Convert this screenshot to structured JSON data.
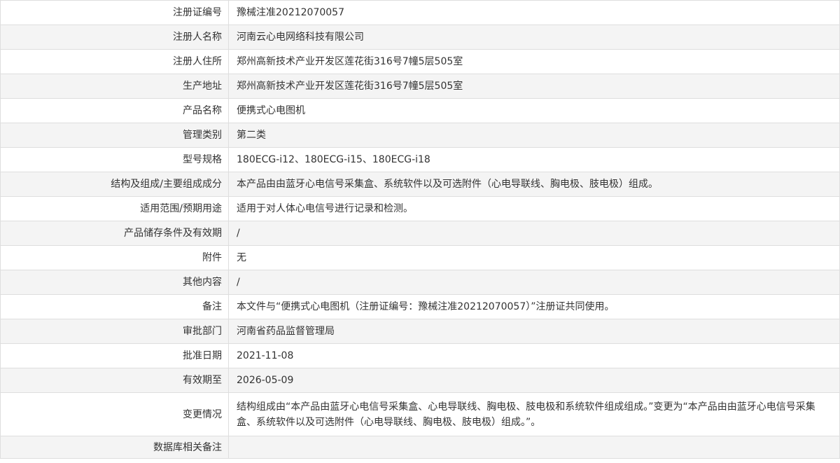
{
  "rows": [
    {
      "label": "注册证编号",
      "value": "豫械注准20212070057"
    },
    {
      "label": "注册人名称",
      "value": "河南云心电网络科技有限公司"
    },
    {
      "label": "注册人住所",
      "value": "郑州高新技术产业开发区莲花街316号7幢5层505室"
    },
    {
      "label": "生产地址",
      "value": "郑州高新技术产业开发区莲花街316号7幢5层505室"
    },
    {
      "label": "产品名称",
      "value": "便携式心电图机"
    },
    {
      "label": "管理类别",
      "value": "第二类"
    },
    {
      "label": "型号规格",
      "value": "180ECG-i12、180ECG-i15、180ECG-i18"
    },
    {
      "label": "结构及组成/主要组成成分",
      "value": "本产品由由蓝牙心电信号采集盒、系统软件以及可选附件（心电导联线、胸电极、肢电极）组成。"
    },
    {
      "label": "适用范围/预期用途",
      "value": "适用于对人体心电信号进行记录和检测。"
    },
    {
      "label": "产品储存条件及有效期",
      "value": "/"
    },
    {
      "label": "附件",
      "value": "无"
    },
    {
      "label": "其他内容",
      "value": "/"
    },
    {
      "label": "备注",
      "value": "本文件与“便携式心电图机（注册证编号：豫械注准20212070057）”注册证共同使用。"
    },
    {
      "label": "审批部门",
      "value": "河南省药品监督管理局"
    },
    {
      "label": "批准日期",
      "value": "2021-11-08"
    },
    {
      "label": "有效期至",
      "value": "2026-05-09"
    },
    {
      "label": "变更情况",
      "value": "结构组成由“本产品由蓝牙心电信号采集盒、心电导联线、胸电极、肢电极和系统软件组成组成。”变更为“本产品由由蓝牙心电信号采集盒、系统软件以及可选附件（心电导联线、胸电极、肢电极）组成。”。"
    },
    {
      "label": "数据库相关备注",
      "value": ""
    }
  ]
}
